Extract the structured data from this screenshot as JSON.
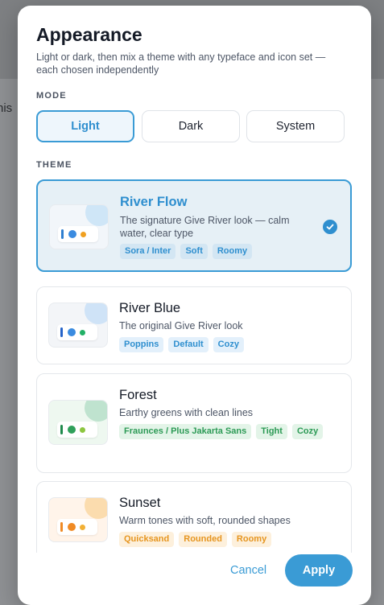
{
  "backdrop": {
    "partial_text": "nis"
  },
  "dialog": {
    "title": "Appearance",
    "subtitle": "Light or dark, then mix a theme with any typeface and icon set — each chosen independently"
  },
  "mode": {
    "label": "MODE",
    "options": [
      "Light",
      "Dark",
      "System"
    ],
    "selected": "Light"
  },
  "theme": {
    "label": "THEME",
    "selected": "River Flow",
    "items": [
      {
        "name": "River Flow",
        "description": "The signature Give River look — calm water, clear type",
        "tags": [
          "Sora / Inter",
          "Soft",
          "Roomy"
        ],
        "colors": {
          "accent": "#3a9bd5",
          "blob": "#cfe6f7",
          "thumb_bg": "#f2f6fa",
          "line": "#2f7fd0",
          "dot1": "#3a8be0",
          "dot2": "#f0a020",
          "tag_bg": "#d3e6f3",
          "tag_text": "#2f8fcf"
        }
      },
      {
        "name": "River Blue",
        "description": "The original Give River look",
        "tags": [
          "Poppins",
          "Default",
          "Cozy"
        ],
        "colors": {
          "accent": "#2f7fd0",
          "blob": "#cfe3f7",
          "thumb_bg": "#f3f5f8",
          "line": "#2563c9",
          "dot1": "#3a8be0",
          "dot2": "#22b066",
          "tag_bg": "#e3f0fb",
          "tag_text": "#2f8fcf"
        }
      },
      {
        "name": "Forest",
        "description": "Earthy greens with clean lines",
        "tags": [
          "Fraunces / Plus Jakarta Sans",
          "Tight",
          "Cozy"
        ],
        "colors": {
          "accent": "#1f9d55",
          "blob": "#bfe3cf",
          "thumb_bg": "#eef8f0",
          "line": "#1f8a4c",
          "dot1": "#2fa05a",
          "dot2": "#8cc63f",
          "tag_bg": "#e3f4e8",
          "tag_text": "#2c9a55"
        }
      },
      {
        "name": "Sunset",
        "description": "Warm tones with soft, rounded shapes",
        "tags": [
          "Quicksand",
          "Rounded",
          "Roomy"
        ],
        "colors": {
          "accent": "#f08a24",
          "blob": "#fbdcae",
          "thumb_bg": "#fff4ea",
          "line": "#f08a24",
          "dot1": "#f08a24",
          "dot2": "#f2b035",
          "tag_bg": "#fdf0dc",
          "tag_text": "#e6951f"
        }
      }
    ]
  },
  "footer": {
    "cancel": "Cancel",
    "apply": "Apply"
  }
}
